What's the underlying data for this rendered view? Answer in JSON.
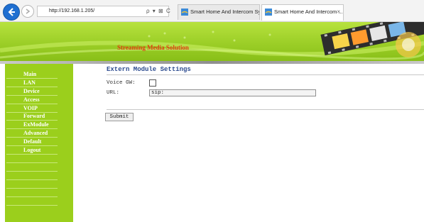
{
  "browser": {
    "address": "http://192.168.1.205/",
    "address_tools": "ρ ▾ ⊠ C",
    "tabs": [
      {
        "label": "Smart Home And Intercom Sys..."
      },
      {
        "label": "Smart Home And Intercom ...",
        "close": "×"
      }
    ]
  },
  "banner": {
    "title": "Streaming Media Solution"
  },
  "sidebar": {
    "items": [
      {
        "label": "Main"
      },
      {
        "label": "LAN"
      },
      {
        "label": "Device"
      },
      {
        "label": "Access"
      },
      {
        "label": "VOIP"
      },
      {
        "label": "Forward"
      },
      {
        "label": "ExModule"
      },
      {
        "label": "Advanced"
      },
      {
        "label": "Default"
      },
      {
        "label": "Logout"
      }
    ]
  },
  "main": {
    "title": "Extern Module Settings",
    "voice_gw_label": "Voice GW:",
    "voice_gw_checked": false,
    "url_label": "URL:",
    "url_value": "sip:",
    "submit_label": "Submit"
  },
  "colors": {
    "banner_green": "#9fd12a",
    "sidebar_green": "#9bcf1c",
    "title_blue": "#2b4a8f",
    "banner_text": "#e23b12"
  }
}
